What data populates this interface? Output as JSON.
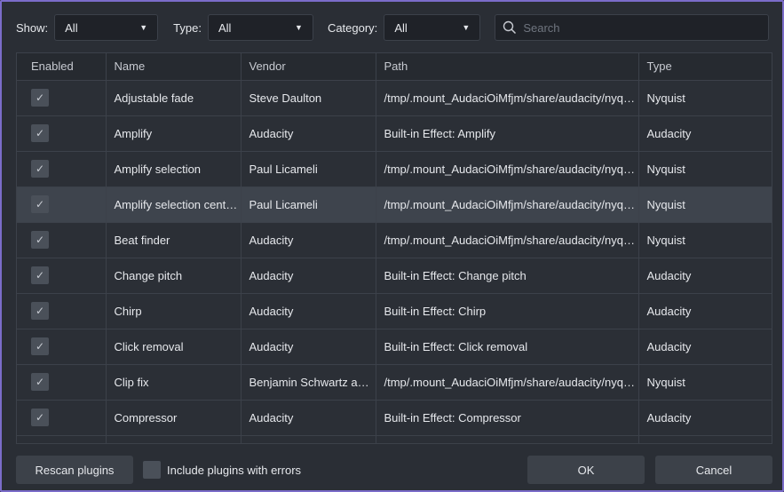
{
  "filters": {
    "show_label": "Show:",
    "show_value": "All",
    "type_label": "Type:",
    "type_value": "All",
    "category_label": "Category:",
    "category_value": "All",
    "caret": "▼",
    "search_placeholder": "Search"
  },
  "table": {
    "headers": [
      "Enabled",
      "Name",
      "Vendor",
      "Path",
      "Type"
    ],
    "check_glyph": "✓",
    "rows": [
      {
        "name": "Adjustable fade",
        "vendor": "Steve Daulton",
        "path": "/tmp/.mount_AudaciOiMfjm/share/audacity/nyquist…",
        "type": "Nyquist"
      },
      {
        "name": "Amplify",
        "vendor": "Audacity",
        "path": "Built-in Effect: Amplify",
        "type": "Audacity"
      },
      {
        "name": "Amplify selection",
        "vendor": "Paul Licameli",
        "path": "/tmp/.mount_AudaciOiMfjm/share/audacity/nyquist…",
        "type": "Nyquist"
      },
      {
        "name": "Amplify selection cente…",
        "vendor": "Paul Licameli",
        "path": "/tmp/.mount_AudaciOiMfjm/share/audacity/nyquist…",
        "type": "Nyquist"
      },
      {
        "name": "Beat finder",
        "vendor": "Audacity",
        "path": "/tmp/.mount_AudaciOiMfjm/share/audacity/nyquist…",
        "type": "Nyquist"
      },
      {
        "name": "Change pitch",
        "vendor": "Audacity",
        "path": "Built-in Effect: Change pitch",
        "type": "Audacity"
      },
      {
        "name": "Chirp",
        "vendor": "Audacity",
        "path": "Built-in Effect: Chirp",
        "type": "Audacity"
      },
      {
        "name": "Click removal",
        "vendor": "Audacity",
        "path": "Built-in Effect: Click removal",
        "type": "Audacity"
      },
      {
        "name": "Clip fix",
        "vendor": "Benjamin Schwartz an…",
        "path": "/tmp/.mount_AudaciOiMfjm/share/audacity/nyquist…",
        "type": "Nyquist"
      },
      {
        "name": "Compressor",
        "vendor": "Audacity",
        "path": "Built-in Effect: Compressor",
        "type": "Audacity"
      }
    ]
  },
  "footer": {
    "rescan_label": "Rescan plugins",
    "include_errors_label": "Include plugins with errors",
    "ok_label": "OK",
    "cancel_label": "Cancel"
  }
}
